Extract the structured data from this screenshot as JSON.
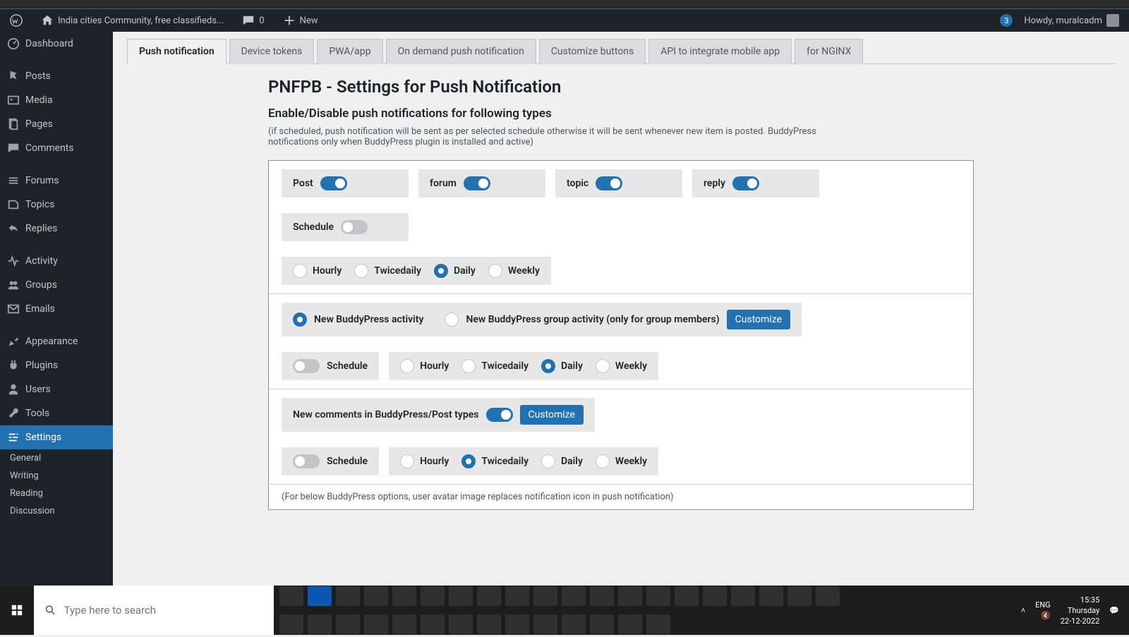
{
  "adminbar": {
    "site_name": "India cities Community, free classifieds...",
    "comments_count": "0",
    "new_label": "New",
    "notif_count": "3",
    "howdy": "Howdy, muralcadm"
  },
  "sidebar": {
    "items": [
      {
        "label": "Dashboard",
        "icon": "dashboard"
      },
      {
        "label": "Posts",
        "icon": "pin"
      },
      {
        "label": "Media",
        "icon": "media"
      },
      {
        "label": "Pages",
        "icon": "pages"
      },
      {
        "label": "Comments",
        "icon": "comments"
      },
      {
        "label": "Forums",
        "icon": "forums"
      },
      {
        "label": "Topics",
        "icon": "topics"
      },
      {
        "label": "Replies",
        "icon": "replies"
      },
      {
        "label": "Activity",
        "icon": "activity"
      },
      {
        "label": "Groups",
        "icon": "groups"
      },
      {
        "label": "Emails",
        "icon": "emails"
      },
      {
        "label": "Appearance",
        "icon": "appearance"
      },
      {
        "label": "Plugins",
        "icon": "plugins"
      },
      {
        "label": "Users",
        "icon": "users"
      },
      {
        "label": "Tools",
        "icon": "tools"
      },
      {
        "label": "Settings",
        "icon": "settings",
        "active": true
      }
    ],
    "sub": [
      "General",
      "Writing",
      "Reading",
      "Discussion"
    ]
  },
  "tabs": [
    "Push notification",
    "Device tokens",
    "PWA/app",
    "On demand push notification",
    "Customize buttons",
    "API to integrate mobile app",
    "for NGINX"
  ],
  "page": {
    "title": "PNFPB - Settings for Push Notification",
    "subtitle": "Enable/Disable push notifications for following types",
    "helper": "(if scheduled, push notification will be sent as per selected schedule otherwise it will be sent whenever new item is posted. BuddyPress notifications only when BuddyPress plugin is installed and active)"
  },
  "section1": {
    "post": "Post",
    "forum": "forum",
    "topic": "topic",
    "reply": "reply",
    "schedule": "Schedule",
    "freq": [
      "Hourly",
      "Twicedaily",
      "Daily",
      "Weekly"
    ]
  },
  "section2": {
    "new_activity": "New BuddyPress activity",
    "new_group": "New BuddyPress group activity (only for group members)",
    "customize": "Customize",
    "schedule": "Schedule",
    "freq": [
      "Hourly",
      "Twicedaily",
      "Daily",
      "Weekly"
    ]
  },
  "section3": {
    "comments": "New comments in BuddyPress/Post types",
    "customize": "Customize",
    "schedule": "Schedule",
    "freq": [
      "Hourly",
      "Twicedaily",
      "Daily",
      "Weekly"
    ]
  },
  "footer_note": "(For below BuddyPress options, user avatar image replaces notification icon in push notification)",
  "taskbar": {
    "search_placeholder": "Type here to search",
    "lang": "ENG",
    "time": "15:35",
    "day": "Thursday",
    "date": "22-12-2022"
  }
}
